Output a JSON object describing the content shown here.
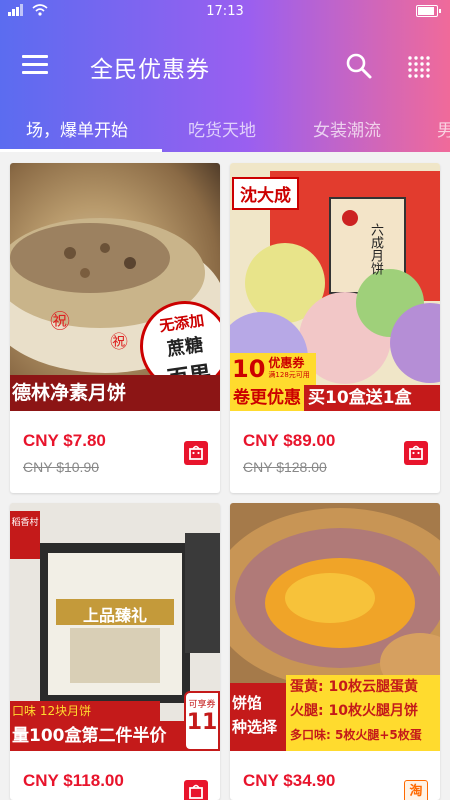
{
  "status": {
    "time": "17:13",
    "battery_level": 0.9
  },
  "appbar": {
    "title": "全民优惠券"
  },
  "tabs": [
    {
      "label": "场，爆单开始",
      "active": true
    },
    {
      "label": "吃货天地",
      "active": false
    },
    {
      "label": "女装潮流",
      "active": false
    },
    {
      "label": "男",
      "active": false
    }
  ],
  "products": [
    {
      "price": "CNY $7.80",
      "original_price": "CNY $10.90",
      "banner": "德林净素月饼",
      "stamp_lines": [
        "无添加",
        "蔗糖",
        "百果"
      ],
      "shop": "tmall-icon"
    },
    {
      "price": "CNY $89.00",
      "original_price": "CNY $128.00",
      "brand": "沈大成",
      "box_label": "六成月饼",
      "coupon_value": "10",
      "coupon_label": "优惠券",
      "coupon_sub": "满128元可用",
      "banner_left": "卷更优惠",
      "banner_right": "买10盒送1盒",
      "shop": "tmall-icon"
    },
    {
      "price": "CNY $118.00",
      "original_price": "",
      "brand_tag": "稻香村",
      "box_label": "上品臻礼",
      "strip": "口味  12块月饼",
      "banner": "量100盒第二件半价",
      "badge": "11",
      "badge_sub": "可享券",
      "shop": "tmall-icon"
    },
    {
      "price": "CNY $34.90",
      "original_price": "",
      "side_top": "饼馅",
      "side_bottom": "种选择",
      "lines": [
        "蛋黄: 10枚云腿蛋黄",
        "火腿: 10枚火腿月饼",
        "多口味: 5枚火腿+5枚蛋"
      ],
      "shop": "taobao-icon",
      "shop_glyph": "淘"
    }
  ],
  "colors": {
    "accent": "#e8142c",
    "tmall": "#e8142c",
    "taobao": "#ff6a00"
  }
}
